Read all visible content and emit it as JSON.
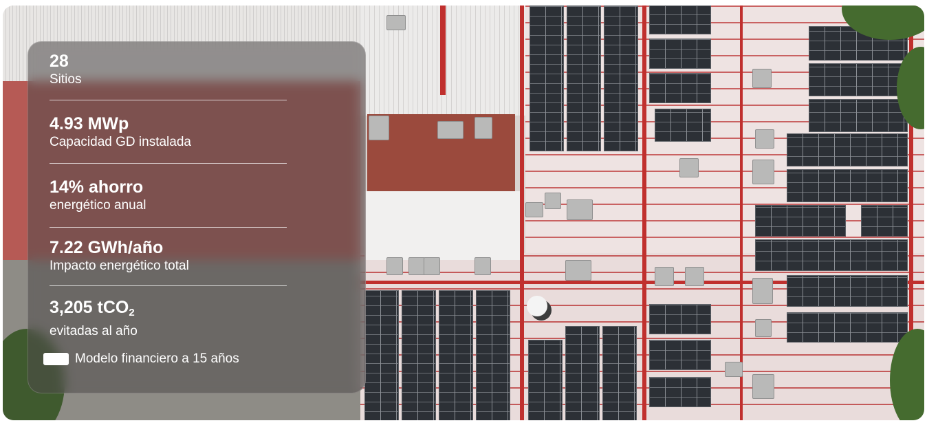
{
  "stats": [
    {
      "value": "28",
      "label": "Sitios"
    },
    {
      "value": "4.93 MWp",
      "label": "Capacidad GD instalada"
    },
    {
      "value": "14% ahorro",
      "label": "energético anual"
    },
    {
      "value": "7.22 GWh/año",
      "label": "Impacto energético total"
    },
    {
      "value": "3,205 tCO",
      "value_subscript": "2",
      "label": "evitadas al año"
    }
  ],
  "legend": {
    "label": "Modelo financiero a 15 años",
    "swatch_color": "#ffffff"
  },
  "colors": {
    "overlay": "#4e4a4a",
    "roof_accent": "#c0302e",
    "text": "#ffffff"
  }
}
